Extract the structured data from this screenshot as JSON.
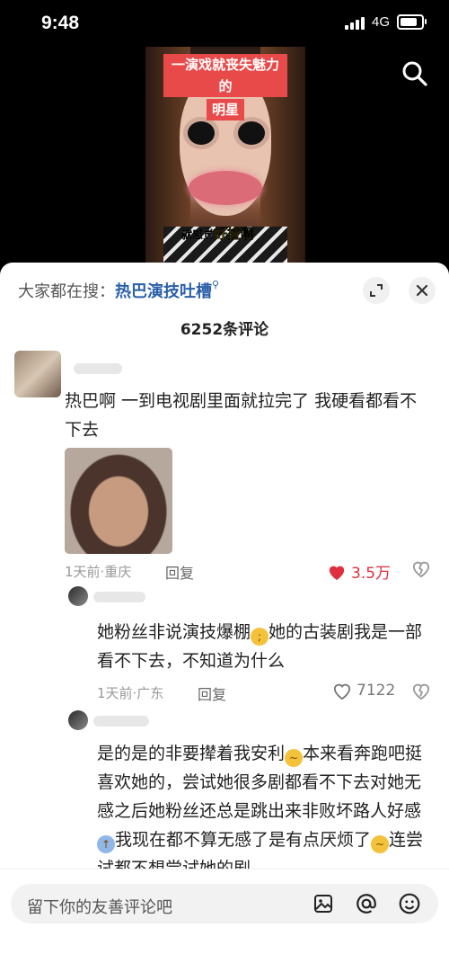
{
  "status": {
    "time": "9:48",
    "network": "4G"
  },
  "video": {
    "caption_line1": "一演戏就丧失魅力的",
    "caption_line2": "明星",
    "subtitle_prefix": "就感觉",
    "subtitle_highlight": "好拉啊"
  },
  "sheet": {
    "search_prefix": "大家都在搜：",
    "search_keyword": "热巴演技吐槽",
    "comment_count": "6252条评论"
  },
  "comments": [
    {
      "text": "热巴啊 一到电视剧里面就拉完了 我硬看都看不下去",
      "meta": "1天前·重庆",
      "reply": "回复",
      "likes": "3.5万",
      "liked": true
    },
    {
      "text_before_emoji": "她粉丝非说演技爆棚",
      "text_after_emoji": "她的古装剧我是一部看不下去，不知道为什么",
      "meta": "1天前·广东",
      "reply": "回复",
      "likes": "7122",
      "liked": false
    },
    {
      "text_part1": "是的是的非要撵着我安利",
      "text_part2": "本来看奔跑吧挺喜欢她的，尝试她很多剧都看不下去对她无感之后她粉丝还总是跳出来非败坏路人好感",
      "text_part3": "我现在都不算无感了是有点厌烦了",
      "text_part4": "连尝试都不想尝试她的剧"
    }
  ],
  "input": {
    "placeholder": "留下你的友善评论吧"
  },
  "icons": {
    "search": "search-icon",
    "expand": "expand-icon",
    "close": "close-icon",
    "heart": "heart-icon",
    "dislike": "broken-heart-icon",
    "image": "image-icon",
    "mention": "at-icon",
    "emoji": "emoji-icon"
  },
  "colors": {
    "accent_link": "#2a5fa8",
    "like_red": "#e02e3d"
  }
}
